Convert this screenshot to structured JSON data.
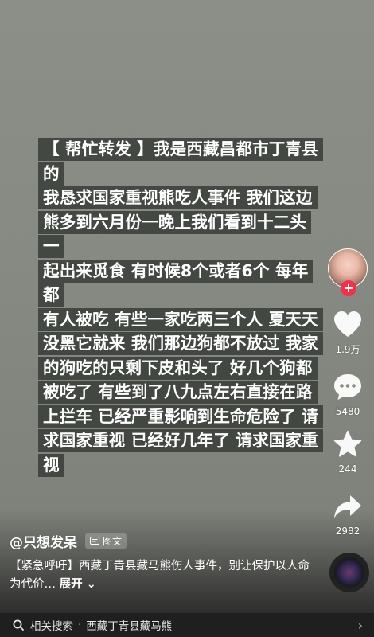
{
  "post": {
    "lines": [
      "【 帮忙转发 】我是西藏昌都市丁青县的",
      "我恳求国家重视熊吃人事件  我们这边",
      "熊多到六月份一晚上我们看到十二头一",
      "起出来觅食  有时候8个或者6个   每年都",
      "有人被吃  有些一家吃两三个人  夏天天",
      "没黑它就来  我们那边狗都不放过  我家",
      "的狗吃的只剩下皮和头了  好几个狗都",
      "被吃了  有些到了八九点左右直接在路",
      "上拦车  已经严重影响到生命危险了  请",
      "求国家重视 已经好几年了 请求国家重",
      "视"
    ]
  },
  "rail": {
    "likes": "1.9万",
    "comments": "5480",
    "favorites": "244",
    "shares": "2982"
  },
  "author": {
    "name": "@只想发呆",
    "badge": "图文"
  },
  "description": {
    "text": "【紧急呼吁】西藏丁青县藏马熊伤人事件，别让保护以人命为代价…",
    "more": "展开"
  },
  "related": {
    "label": "相关搜索",
    "separator": "·",
    "query": "西藏丁青县藏马熊"
  },
  "colors": {
    "accent": "#f0324a",
    "background": "#8a8d86",
    "text_block": "#3a3f3a"
  },
  "icons": {
    "like": "heart-icon",
    "comment": "comment-icon",
    "favorite": "star-icon",
    "share": "share-icon",
    "search": "search-icon",
    "badge": "image-text-icon"
  }
}
